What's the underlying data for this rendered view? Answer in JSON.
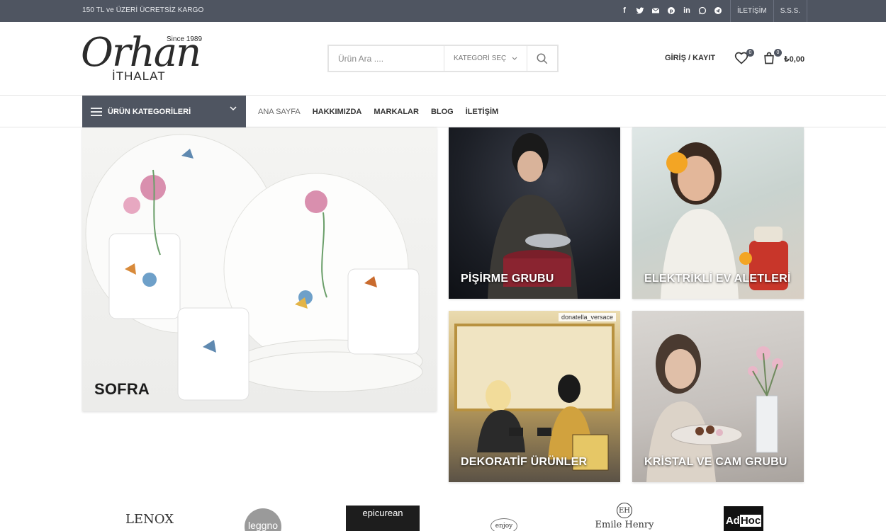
{
  "topbar": {
    "promo": "150 TL ve ÜZERİ ÜCRETSİZ KARGO",
    "socials": [
      "facebook-icon",
      "twitter-icon",
      "email-icon",
      "pinterest-icon",
      "linkedin-icon",
      "whatsapp-icon",
      "telegram-icon"
    ],
    "links": [
      "İLETİŞİM",
      "S.S.S."
    ],
    "bg_color": "#4f5561"
  },
  "header": {
    "logo": {
      "script": "Orhan",
      "sub": "İTHALAT",
      "since": "Since 1989"
    },
    "search": {
      "placeholder": "Ürün Ara ....",
      "category": "KATEGORİ SEÇ"
    },
    "login": "GİRİŞ / KAYIT",
    "wishlist_count": "0",
    "cart_count": "0",
    "cart_total": "₺0,00"
  },
  "nav": {
    "categories_button": "ÜRÜN KATEGORİLERİ",
    "items": [
      "ANA SAYFA",
      "HAKKIMIZDA",
      "MARKALAR",
      "BLOG",
      "İLETİŞİM"
    ],
    "active": "ANA SAYFA"
  },
  "banners": {
    "sofra": "SOFRA",
    "pisirme": "PİŞİRME GRUBU",
    "elektrik": "ELEKTRİKLİ EV ALETLERİ",
    "dekor": "DEKORATİF ÜRÜNLER",
    "dekor_tag": "donatella_versace",
    "kristal": "KRİSTAL VE CAM GRUBU"
  },
  "brands": {
    "lenox": "LENOX",
    "leggno": "leggno",
    "epicurean": "epicurean",
    "enjoy": "enjoy",
    "emile_mono": "EH",
    "emile": "Emile Henry",
    "adhoc_a": "Ad",
    "adhoc_b": "Hoc"
  }
}
